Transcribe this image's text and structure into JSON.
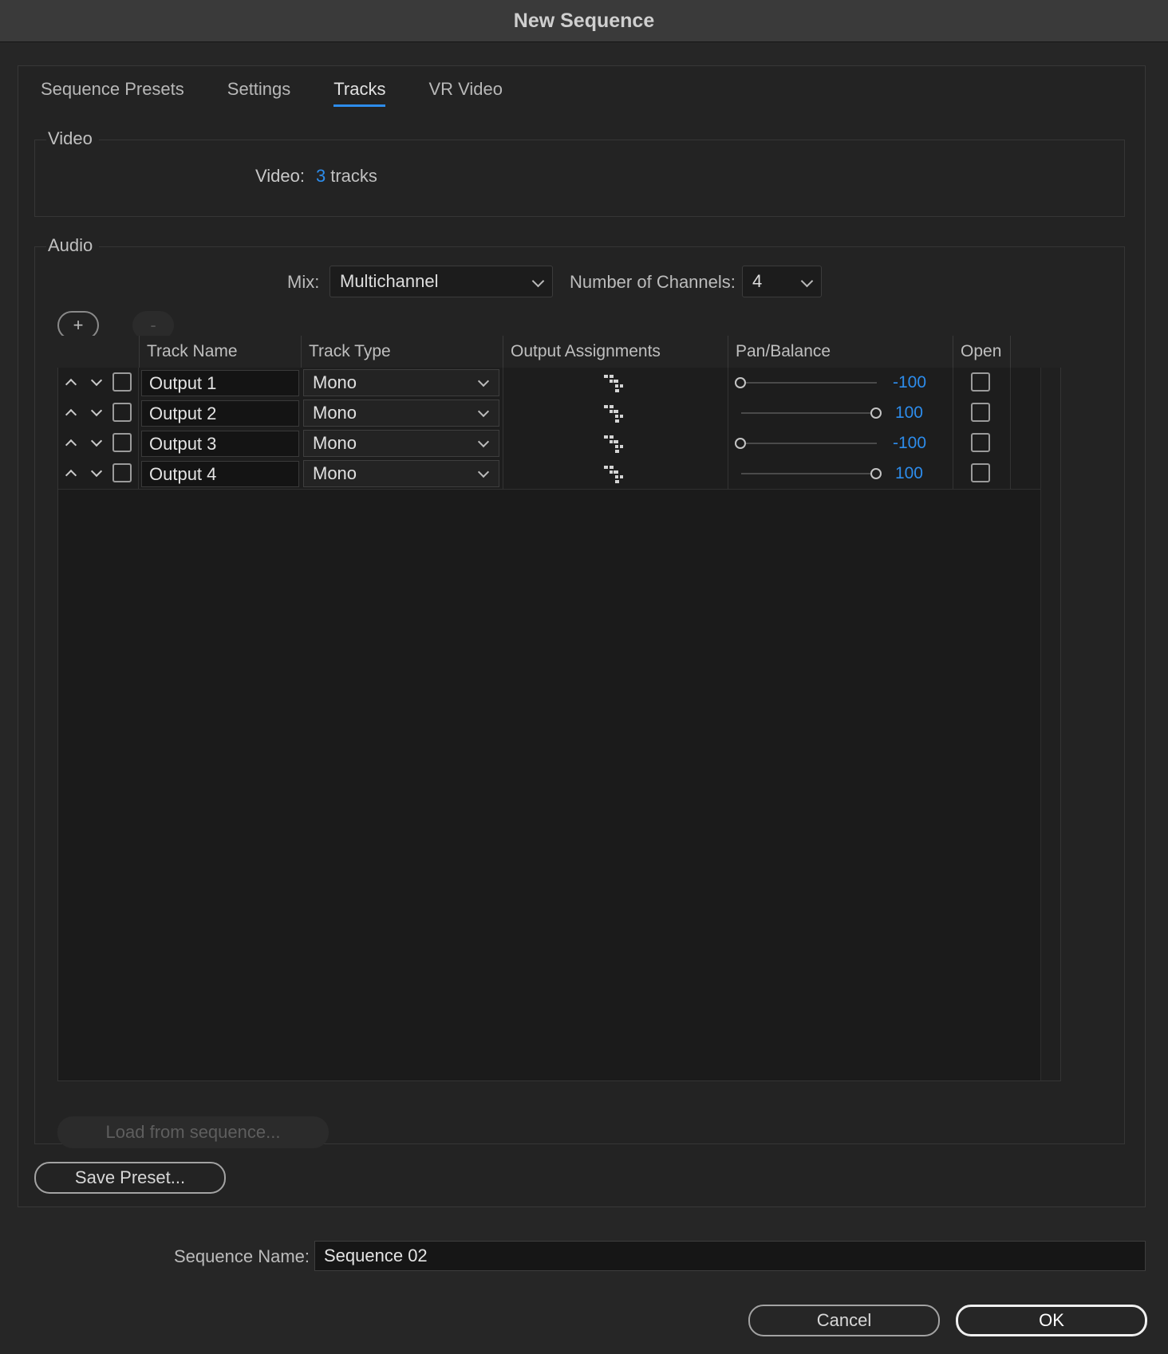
{
  "window": {
    "title": "New Sequence"
  },
  "tabs": [
    {
      "label": "Sequence Presets",
      "active": false
    },
    {
      "label": "Settings",
      "active": false
    },
    {
      "label": "Tracks",
      "active": true
    },
    {
      "label": "VR Video",
      "active": false
    }
  ],
  "video": {
    "group_label": "Video",
    "label": "Video:",
    "count": "3",
    "unit": "tracks"
  },
  "audio": {
    "group_label": "Audio",
    "mix_label": "Mix:",
    "mix_value": "Multichannel",
    "channels_label": "Number of Channels:",
    "channels_value": "4",
    "add_label": "+",
    "remove_label": "-",
    "columns": [
      "Track Name",
      "Track Type",
      "Output Assignments",
      "Pan/Balance",
      "Open"
    ],
    "tracks": [
      {
        "name": "Output 1",
        "type": "Mono",
        "pan": "-100",
        "pan_value": -100
      },
      {
        "name": "Output 2",
        "type": "Mono",
        "pan": "100",
        "pan_value": 100
      },
      {
        "name": "Output 3",
        "type": "Mono",
        "pan": "-100",
        "pan_value": -100
      },
      {
        "name": "Output 4",
        "type": "Mono",
        "pan": "100",
        "pan_value": 100
      }
    ],
    "load_label": "Load from sequence..."
  },
  "save_preset_label": "Save Preset...",
  "sequence_name": {
    "label": "Sequence Name:",
    "value": "Sequence 02"
  },
  "buttons": {
    "cancel": "Cancel",
    "ok": "OK"
  },
  "colors": {
    "accent": "#2d8ceb",
    "background": "#262626"
  }
}
